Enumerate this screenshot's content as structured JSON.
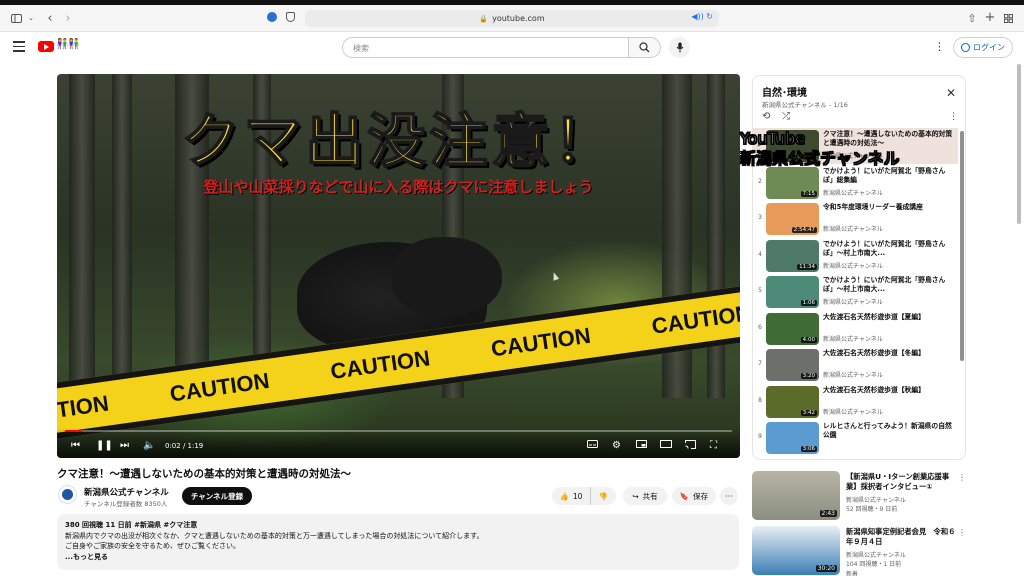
{
  "browser": {
    "url": "youtube.com"
  },
  "header": {
    "search_placeholder": "検索",
    "login_label": "ログイン"
  },
  "player": {
    "title_text": "クマ出没注意！",
    "subtitle_text": "登山や山菜採りなどで山に入る際はクマに注意しましょう",
    "tape_words": [
      "TION",
      "CAUTION",
      "CAUTION",
      "CAUTION",
      "CAUTION"
    ],
    "time": "0:02 / 1:19",
    "progress_fraction": 0.025
  },
  "video": {
    "title": "クマ注意！〜遭遇しないための基本的対策と遭遇時の対処法〜",
    "channel": "新潟県公式チャンネル",
    "subscribers": "チャンネル登録者数 8350人",
    "subscribe_label": "チャンネル登録",
    "likes": "10",
    "share_label": "共有",
    "save_label": "保存",
    "desc_meta": "380 回視聴  11 日前  #新潟県 #クマ注意",
    "desc_line1": "新潟県内でクマの出没が相次ぐなか、クマと遭遇しないための基本的対策と万一遭遇してしまった場合の対処法について紹介します。",
    "desc_line2": "ご自身やご家族の安全を守るため、ぜひご覧ください。",
    "desc_more": "...もっと見る"
  },
  "watermark": {
    "line1": "YouTube",
    "line2": "新潟県公式チャンネル"
  },
  "playlist": {
    "title": "自然･環境",
    "subtitle": "新潟県公式チャンネル - 1/16",
    "items": [
      {
        "idx": "▶",
        "title": "クマ注意！〜遭遇しないための基本的対策と遭遇時の対処法〜",
        "channel": "新潟県公式チャンネル",
        "duration": "",
        "color": "#3d4a2e"
      },
      {
        "idx": "2",
        "title": "でかけよう！にいがた阿賀北「野鳥さんぽ」総集編",
        "channel": "新潟県公式チャンネル",
        "duration": "7:15",
        "color": "#6e8a55"
      },
      {
        "idx": "3",
        "title": "令和5年度環境リーダー養成講座",
        "channel": "新潟県公式チャンネル",
        "duration": "2:54:47",
        "color": "#e89a5a"
      },
      {
        "idx": "4",
        "title": "でかけよう！にいがた阿賀北「野鳥さんぽ」〜村上市南大...",
        "channel": "新潟県公式チャンネル",
        "duration": "11:34",
        "color": "#4f7a6a"
      },
      {
        "idx": "5",
        "title": "でかけよう！にいがた阿賀北「野鳥さんぽ」〜村上市南大...",
        "channel": "新潟県公式チャンネル",
        "duration": "1:06",
        "color": "#4d8a78"
      },
      {
        "idx": "6",
        "title": "大佐渡石名天然杉遊歩道【夏編】",
        "channel": "新潟県公式チャンネル",
        "duration": "4:00",
        "color": "#3f6b35"
      },
      {
        "idx": "7",
        "title": "大佐渡石名天然杉遊歩道【冬編】",
        "channel": "新潟県公式チャンネル",
        "duration": "3:20",
        "color": "#6d6f6a"
      },
      {
        "idx": "8",
        "title": "大佐渡石名天然杉遊歩道【秋編】",
        "channel": "新潟県公式チャンネル",
        "duration": "3:42",
        "color": "#5a6b2a"
      },
      {
        "idx": "9",
        "title": "レルヒさんと行ってみよう！新潟県の自然公園",
        "channel": "",
        "duration": "3:06",
        "color": "#5c9bd1"
      }
    ]
  },
  "recommended": [
    {
      "title": "【新潟県U・Iターン創業応援事業】採択者インタビュー①",
      "channel": "新潟県公式チャンネル",
      "meta": "52 回視聴・9 日前",
      "duration": "2:43",
      "color": "#8c8f80"
    },
    {
      "title": "新潟県知事定例記者会見　令和６年９月４日",
      "channel": "新潟県公式チャンネル",
      "meta": "104 回視聴・1 日前",
      "extra": "新着",
      "duration": "30:20",
      "color": "#3b7fb5"
    }
  ]
}
